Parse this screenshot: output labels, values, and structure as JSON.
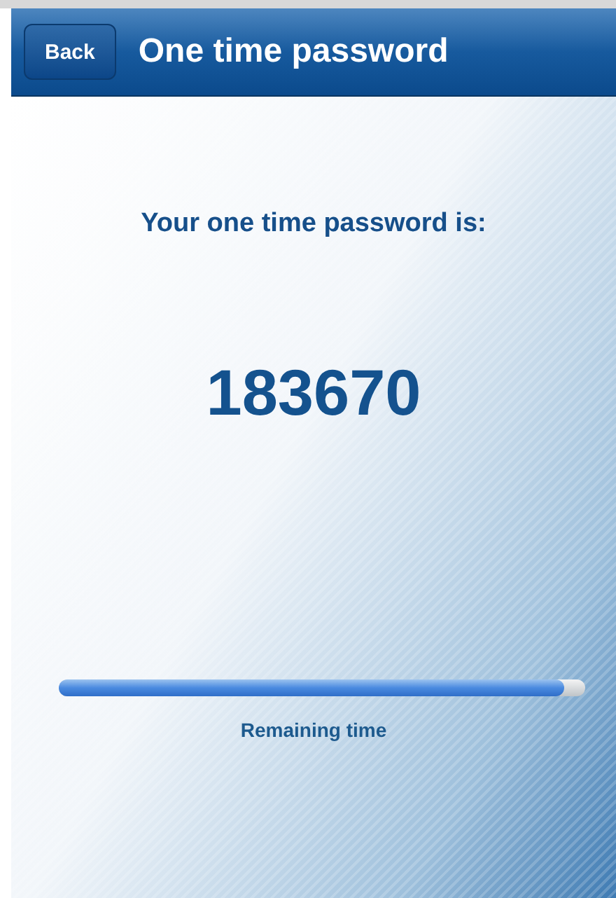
{
  "nav_bar": {
    "back_button": "Back",
    "title": "One time password"
  },
  "prompt": "Your one time password is:",
  "password": "183670",
  "timer": {
    "level": 0.96,
    "label": "Remaining time"
  }
}
